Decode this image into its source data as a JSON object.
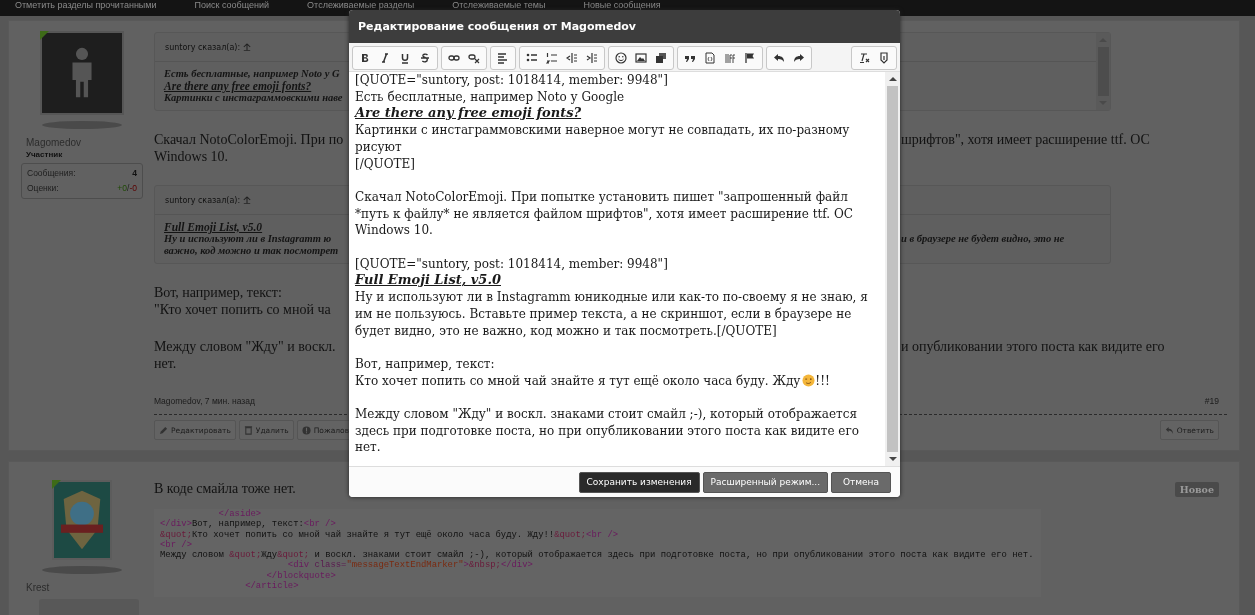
{
  "top_nav": {
    "links": [
      "Отметить разделы прочитанными",
      "Поиск сообщений",
      "Отслеживаемые разделы",
      "Отслеживаемые темы",
      "Новые сообщения"
    ]
  },
  "post_1": {
    "author": "Magomedov",
    "role": "Участник",
    "stats": [
      {
        "label": "Сообщения:",
        "value": "4"
      }
    ],
    "ratings": {
      "label": "Оценки:",
      "positive": "+0",
      "separator": "/",
      "negative": "-0"
    },
    "body": [
      {
        "kind": "quote",
        "header": "suntory сказал(а):",
        "scrollable": true,
        "lines": [
          {
            "kind": "text",
            "left": "Есть бесплатные, например Noto у G"
          },
          {
            "kind": "link",
            "left": "Are there any free emoji fonts?"
          },
          {
            "kind": "text",
            "left": "Картинки с инстаграммовскими наве"
          }
        ]
      },
      {
        "kind": "paragraph",
        "lines": [
          {
            "left": "Скачал NotoColorEmoji. При по",
            "right": "шрифтов\", хотя имеет расширение ttf. ОС"
          },
          {
            "left": "Windows 10."
          }
        ]
      },
      {
        "kind": "quote",
        "header": "suntory сказал(а):",
        "scrollable": false,
        "lines": [
          {
            "kind": "link",
            "left": "Full Emoji List, v5.0"
          },
          {
            "kind": "text",
            "left": "Ну и используют ли в Instagramm ю",
            "right": "и в браузере не будет видно, это не"
          },
          {
            "kind": "text",
            "left": "важно, код можно и так посмотрет"
          }
        ]
      },
      {
        "kind": "paragraph",
        "lines": [
          {
            "left": "Вот, например, текст:"
          },
          {
            "left": "\"Кто хочет попить со мной ча"
          }
        ]
      },
      {
        "kind": "paragraph",
        "lines": [
          {
            "left": "Между словом \"Жду\" и воскл.",
            "right": "и опубликовании этого поста как видите его"
          },
          {
            "left": "нет."
          }
        ]
      }
    ],
    "meta": "Magomedov, 7 мин. назад",
    "number": "#19",
    "actions": [
      {
        "kind": "edit",
        "label": "Редактировать"
      },
      {
        "kind": "delete",
        "label": "Удалить"
      },
      {
        "kind": "report",
        "label": "Пожалов"
      }
    ],
    "reply": {
      "kind": "reply",
      "label": "Ответить"
    }
  },
  "post_2": {
    "author": "Krest",
    "text": "В коде смайла тоже нет.",
    "badge": "Новое",
    "code": [
      [
        {
          "kind": "tag",
          "text": "           </aside>"
        }
      ],
      [
        {
          "kind": "tag",
          "text": "</div>"
        },
        {
          "kind": "text",
          "text": "Вот, например, текст:"
        },
        {
          "kind": "tag",
          "text": "<br />"
        }
      ],
      [
        {
          "kind": "entity",
          "text": "&quot;"
        },
        {
          "kind": "text",
          "text": "Кто хочет попить со мной чай знайте я тут ещё около часа буду. Жду!!"
        },
        {
          "kind": "entity",
          "text": "&quot;"
        },
        {
          "kind": "tag",
          "text": "<br />"
        }
      ],
      [
        {
          "kind": "tag",
          "text": "<br />"
        }
      ],
      [
        {
          "kind": "text",
          "text": "Между словом "
        },
        {
          "kind": "entity",
          "text": "&quot;"
        },
        {
          "kind": "text",
          "text": "Жду"
        },
        {
          "kind": "entity",
          "text": "&quot;"
        },
        {
          "kind": "text",
          "text": " и воскл. знаками стоит смайл ;-), который отображается здесь при подготовке поста, но при опубликовании этого поста как видите его нет."
        }
      ],
      [
        {
          "kind": "tag",
          "text": "                        <div "
        },
        {
          "kind": "attr",
          "text": "class="
        },
        {
          "kind": "value",
          "text": "\"messageTextEndMarker\""
        },
        {
          "kind": "tag",
          "text": ">"
        },
        {
          "kind": "entity",
          "text": "&nbsp;"
        },
        {
          "kind": "tag",
          "text": "</div>"
        }
      ],
      [
        {
          "kind": "tag",
          "text": "                    </blockquote>"
        }
      ],
      [
        {
          "kind": "tag",
          "text": "                </article>"
        }
      ]
    ]
  },
  "dialog": {
    "title": "Редактирование сообщения от Magomedov",
    "editor": [
      [
        {
          "kind": "text",
          "text": "[QUOTE=\"suntory, post: 1018414, member: 9948\"]"
        },
        {
          "kind": "text",
          "text": "Есть бесплатные, например Noto у Google"
        },
        {
          "kind": "link",
          "text": "Are there any free emoji fonts?"
        },
        {
          "kind": "text",
          "text": "Картинки с инстаграммовскими наверное могут не совпадать, их по-разному рисуют"
        },
        {
          "kind": "text",
          "text": "[/QUOTE]"
        }
      ],
      [
        {
          "kind": "text",
          "text": "Скачал NotoColorEmoji. При попытке установить пишет \"запрошенный файл *путь к файлу* не является файлом шрифтов\", хотя имеет расширение ttf. ОС Windows 10."
        }
      ],
      [
        {
          "kind": "text",
          "text": "[QUOTE=\"suntory, post: 1018414, member: 9948\"]"
        },
        {
          "kind": "link",
          "text": "Full Emoji List, v5.0"
        },
        {
          "kind": "text",
          "text": "Ну и используют ли в Instagramm юникодные или как-то по-своему я не знаю, я им не пользуюсь. Вставьте пример текста, а не скриншот, если в браузере не будет видно, это не важно, код можно и так посмотреть.[/QUOTE]"
        }
      ],
      [
        {
          "kind": "text",
          "text": "Вот, например, текст:"
        },
        {
          "kind": "emoji",
          "text": "Кто хочет попить со мной чай знайте я тут ещё около часа буду. Жду",
          "tail": "!!!"
        }
      ],
      [
        {
          "kind": "text",
          "text": "Между словом \"Жду\" и воскл. знаками стоит смайл ;-), который отображается здесь при подготовке поста, но при опубликовании этого поста как видите его нет."
        }
      ]
    ],
    "buttons": [
      {
        "kind": "primary",
        "label": "Сохранить изменения"
      },
      {
        "kind": "secondary",
        "label": "Расширенный режим..."
      },
      {
        "kind": "secondary",
        "label": "Отмена"
      }
    ]
  }
}
